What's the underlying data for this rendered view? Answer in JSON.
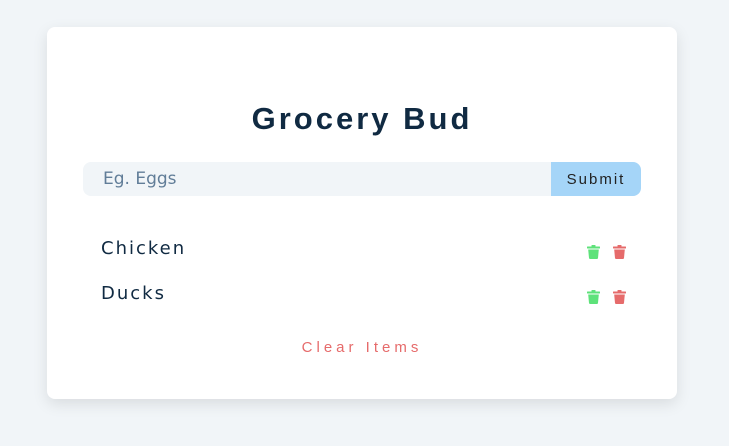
{
  "app": {
    "title": "Grocery Bud"
  },
  "form": {
    "input_value": "",
    "input_placeholder": "Eg. Eggs",
    "submit_label": "Submit"
  },
  "items": [
    {
      "title": "Chicken"
    },
    {
      "title": "Ducks"
    }
  ],
  "icons": {
    "edit": "trash-icon-green",
    "delete": "trash-icon-red"
  },
  "colors": {
    "background": "#f1f5f8",
    "card": "#ffffff",
    "title": "#102a42",
    "submit_bg": "#a5d5f8",
    "edit_icon": "#5ee27a",
    "delete_icon": "#e66b6b",
    "clear_text": "#e66b6b"
  },
  "clear": {
    "label": "Clear Items"
  }
}
